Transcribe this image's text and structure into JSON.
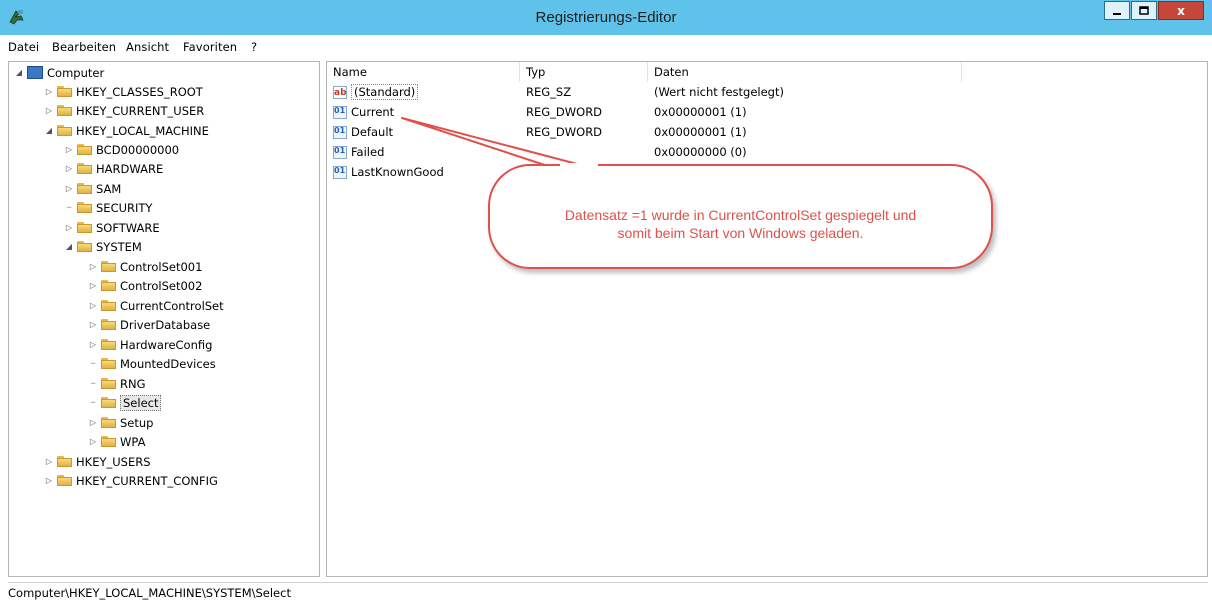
{
  "window": {
    "title": "Registrierungs-Editor",
    "controls": [
      "minimize",
      "maximize",
      "close"
    ],
    "close_glyph": "x"
  },
  "menu": [
    "Datei",
    "Bearbeiten",
    "Ansicht",
    "Favoriten",
    "?"
  ],
  "tree": [
    {
      "label": "Computer",
      "twisty": "expanded",
      "icon": "computer-icon"
    },
    {
      "label": "HKEY_CLASSES_ROOT",
      "twisty": "collapsed"
    },
    {
      "label": "HKEY_CURRENT_USER",
      "twisty": "collapsed"
    },
    {
      "label": "HKEY_LOCAL_MACHINE",
      "twisty": "expanded"
    },
    {
      "label": "BCD00000000",
      "twisty": "collapsed"
    },
    {
      "label": "HARDWARE",
      "twisty": "collapsed"
    },
    {
      "label": "SAM",
      "twisty": "collapsed"
    },
    {
      "label": "SECURITY",
      "twisty": "none"
    },
    {
      "label": "SOFTWARE",
      "twisty": "collapsed"
    },
    {
      "label": "SYSTEM",
      "twisty": "expanded"
    },
    {
      "label": "ControlSet001",
      "twisty": "collapsed"
    },
    {
      "label": "ControlSet002",
      "twisty": "collapsed"
    },
    {
      "label": "CurrentControlSet",
      "twisty": "collapsed"
    },
    {
      "label": "DriverDatabase",
      "twisty": "collapsed"
    },
    {
      "label": "HardwareConfig",
      "twisty": "collapsed"
    },
    {
      "label": "MountedDevices",
      "twisty": "none"
    },
    {
      "label": "RNG",
      "twisty": "none"
    },
    {
      "label": "Select",
      "twisty": "none",
      "selected": true
    },
    {
      "label": "Setup",
      "twisty": "collapsed"
    },
    {
      "label": "WPA",
      "twisty": "collapsed"
    },
    {
      "label": "HKEY_USERS",
      "twisty": "collapsed"
    },
    {
      "label": "HKEY_CURRENT_CONFIG",
      "twisty": "collapsed"
    }
  ],
  "columns": [
    "Name",
    "Typ",
    "Daten"
  ],
  "values": [
    {
      "name": "(Standard)",
      "type": "REG_SZ",
      "data": "(Wert nicht festgelegt)",
      "icon": "string-value-icon",
      "icon_text": "ab"
    },
    {
      "name": "Current",
      "type": "REG_DWORD",
      "data": "0x00000001 (1)",
      "icon": "dword-value-icon",
      "icon_text": "011"
    },
    {
      "name": "Default",
      "type": "REG_DWORD",
      "data": "0x00000001 (1)",
      "icon": "dword-value-icon",
      "icon_text": "011"
    },
    {
      "name": "Failed",
      "type": "",
      "data": "0x00000000 (0)",
      "icon": "dword-value-icon",
      "icon_text": "011"
    },
    {
      "name": "LastKnownGood",
      "type": "",
      "data": "",
      "icon": "dword-value-icon",
      "icon_text": "011"
    }
  ],
  "callout": {
    "line1": "Datensatz =1 wurde in CurrentControlSet gespiegelt und",
    "line2": "somit beim Start von Windows geladen.",
    "color": "#e0514c"
  },
  "status": {
    "path": "Computer\\HKEY_LOCAL_MACHINE\\SYSTEM\\Select"
  },
  "colors": {
    "titlebar": "#5fc2ea",
    "close_button": "#c7463a"
  }
}
